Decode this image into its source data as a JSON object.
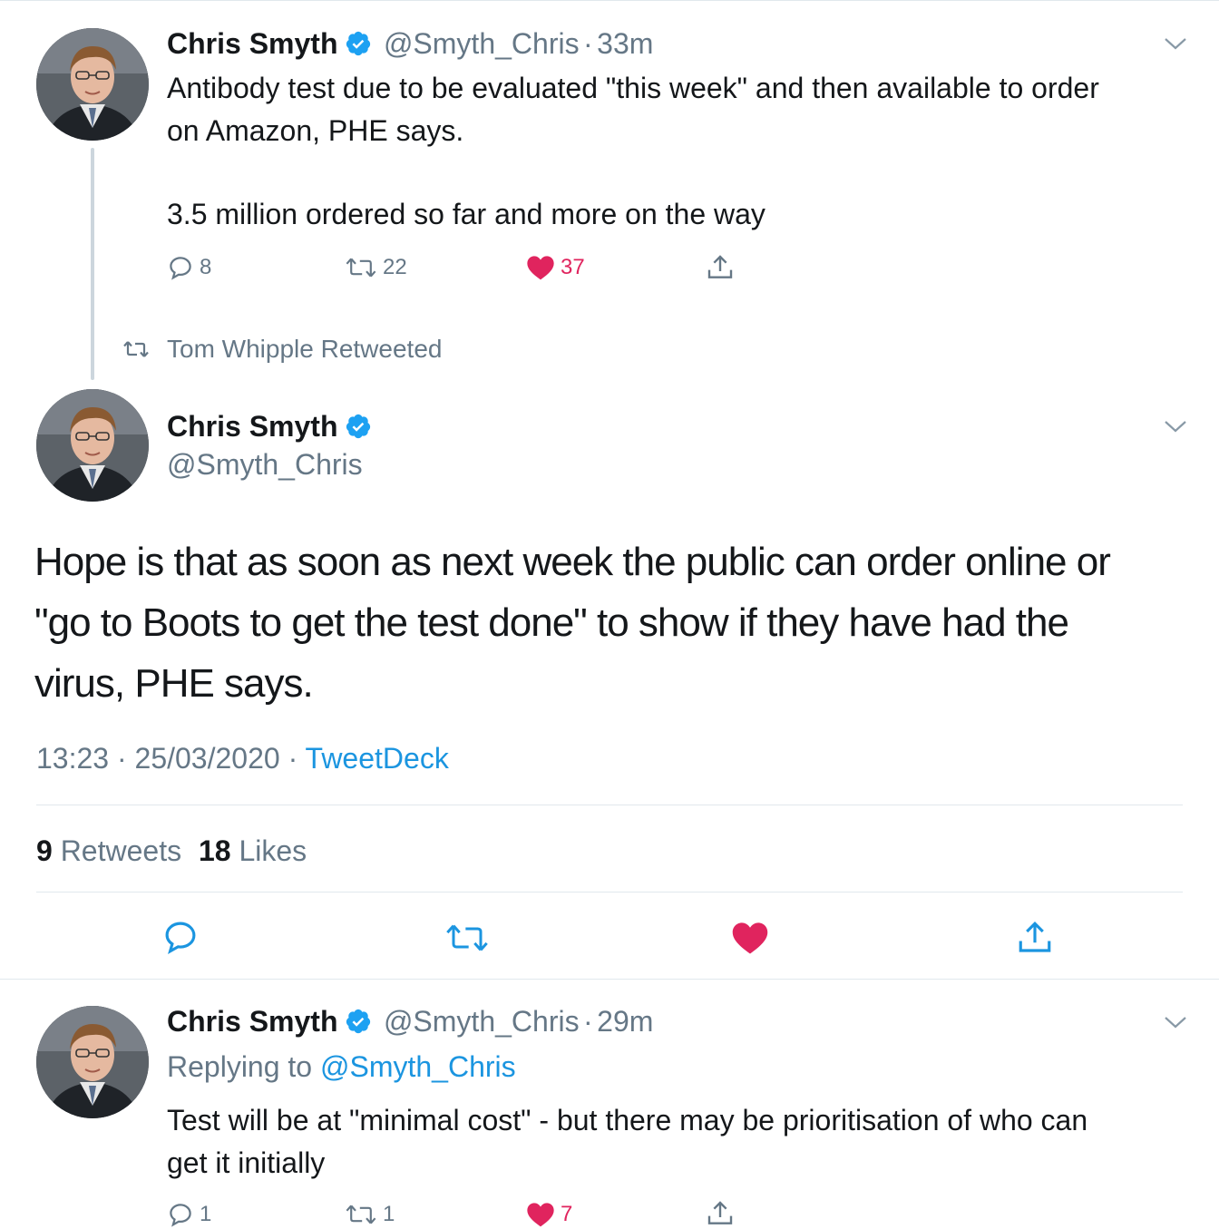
{
  "colors": {
    "accent": "#1b95e0",
    "like": "#e0245e",
    "secondary_text": "#657786",
    "divider": "#e1e8ed"
  },
  "tweet1": {
    "name": "Chris Smyth",
    "handle": "@Smyth_Chris",
    "separator": "·",
    "time": "33m",
    "text_line1": "Antibody test due to be evaluated \"this week\" and then available to order",
    "text_line2": "on Amazon, PHE says.",
    "text_line3": "3.5 million ordered so far and more on the way",
    "replies": "8",
    "retweets": "22",
    "likes": "37"
  },
  "retweet_context": {
    "label": "Tom Whipple Retweeted"
  },
  "main_tweet": {
    "name": "Chris Smyth",
    "handle": "@Smyth_Chris",
    "text_line1": "Hope is that as soon as next week the public can order online or",
    "text_line2": "\"go to Boots to get the test done\" to show if they have had the",
    "text_line3": "virus, PHE says.",
    "time": "13:23",
    "date": "25/03/2020",
    "sep": "·",
    "source": "TweetDeck",
    "retweet_count": "9",
    "retweet_label": "Retweets",
    "like_count": "18",
    "like_label": "Likes"
  },
  "tweet3": {
    "name": "Chris Smyth",
    "handle": "@Smyth_Chris",
    "separator": "·",
    "time": "29m",
    "replying_label": "Replying to",
    "replying_handle": "@Smyth_Chris",
    "text_line1": "Test will be at \"minimal cost\" - but there may be prioritisation of who can",
    "text_line2": "get it initially",
    "replies": "1",
    "retweets": "1",
    "likes": "7"
  },
  "icons": {
    "reply": "reply-icon",
    "retweet": "retweet-icon",
    "like": "heart-icon",
    "share": "share-icon",
    "verified": "verified-badge-icon",
    "caret": "chevron-down-icon"
  }
}
